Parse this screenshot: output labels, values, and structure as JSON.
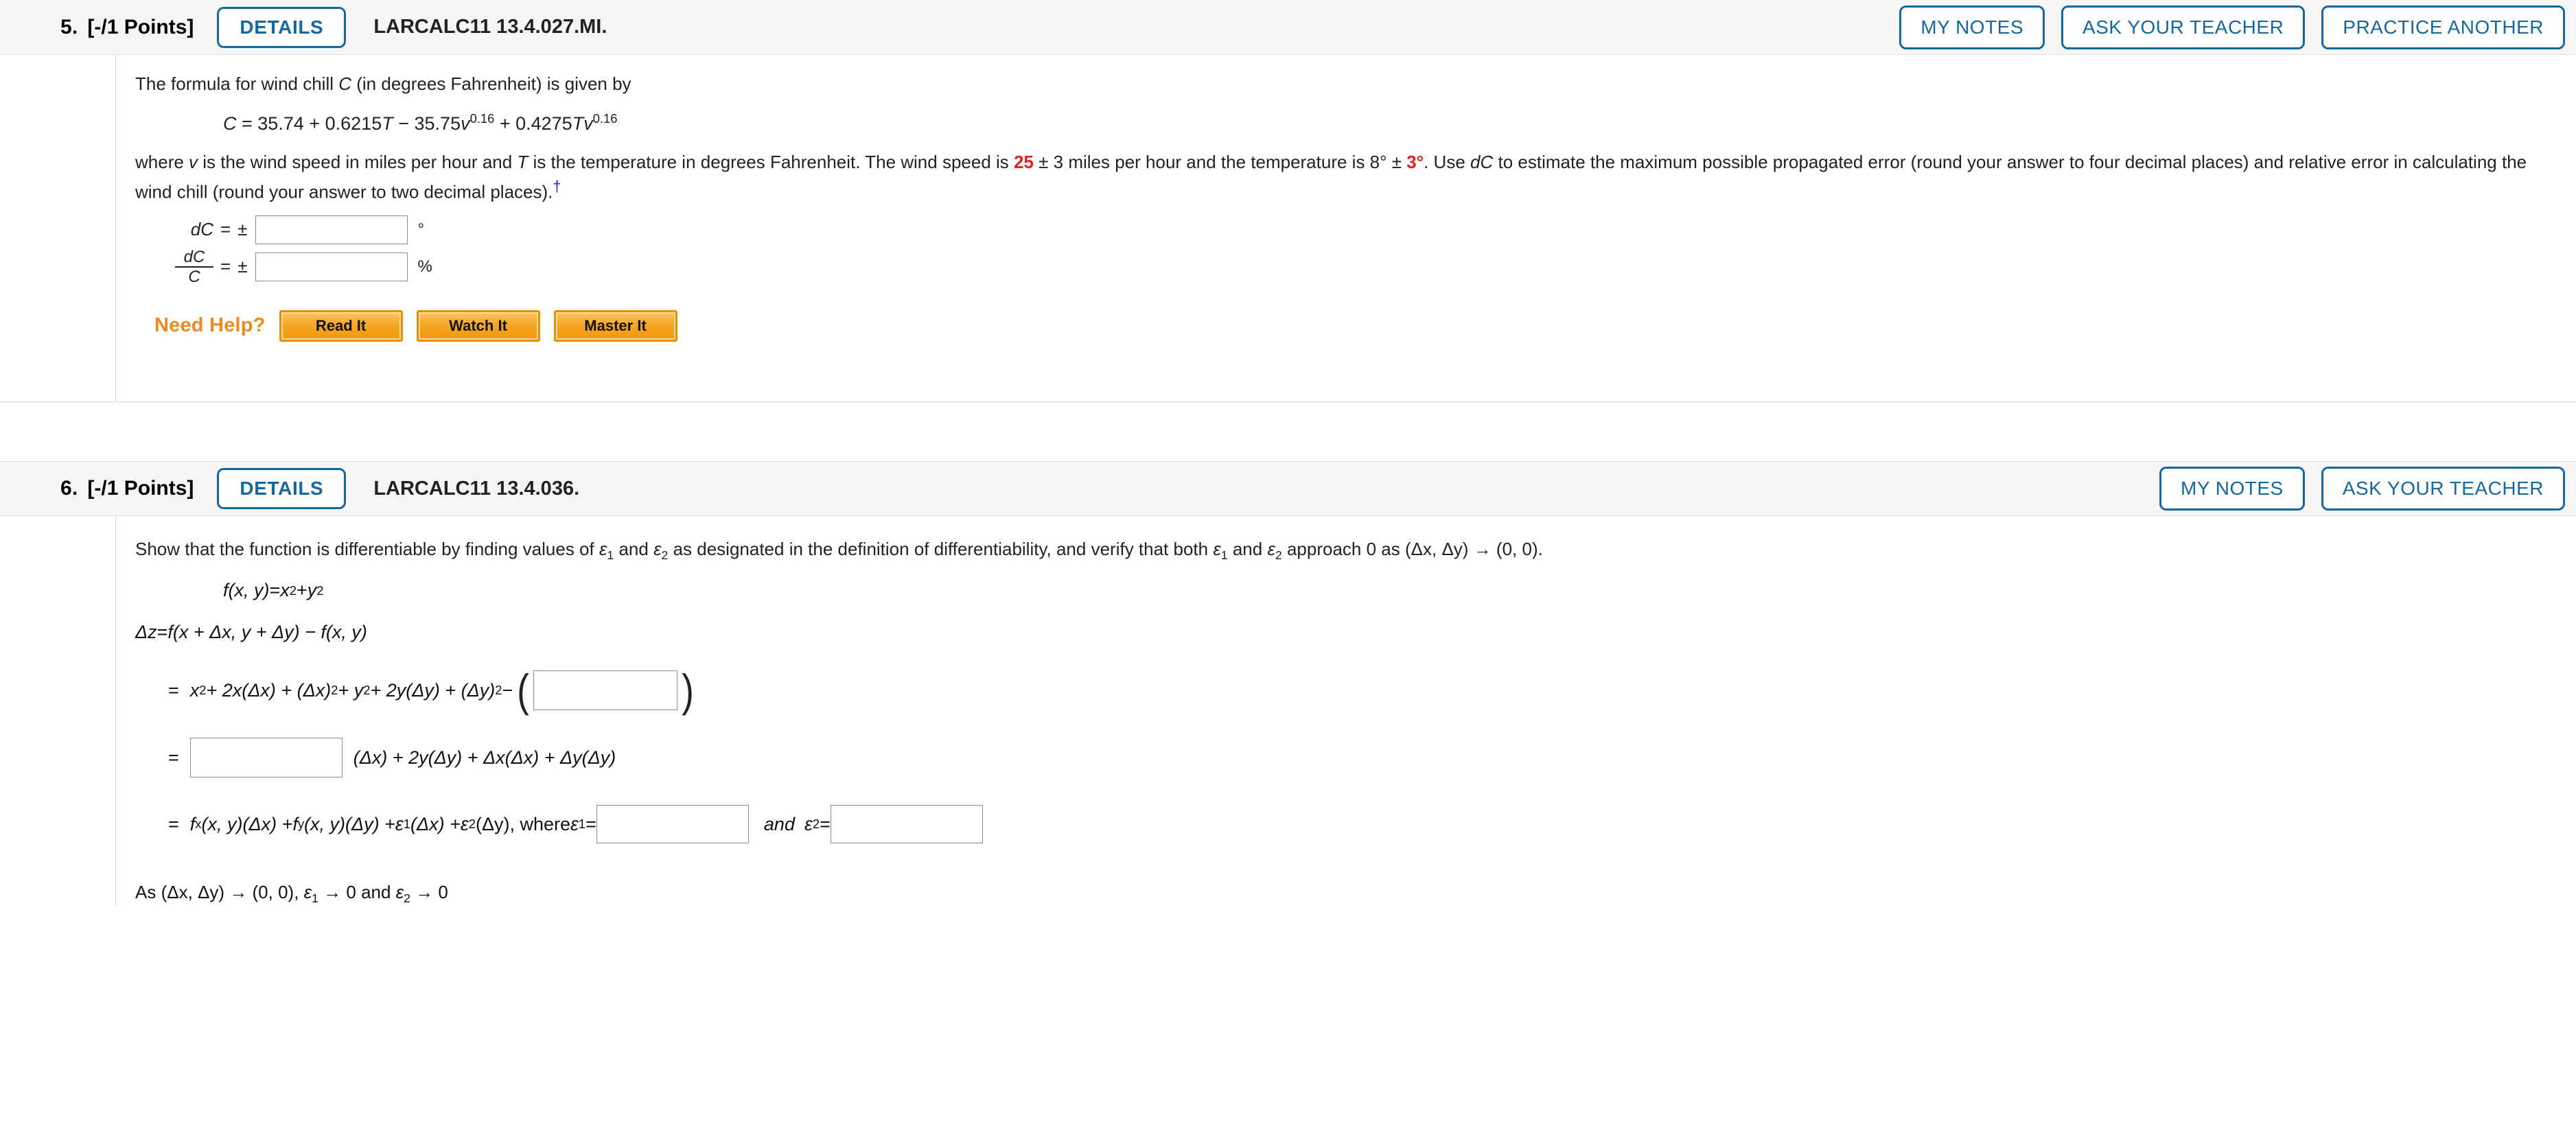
{
  "problems": [
    {
      "number": "5.",
      "points": "[-/1 Points]",
      "details_label": "DETAILS",
      "code": "LARCALC11 13.4.027.MI.",
      "actions": [
        "MY NOTES",
        "ASK YOUR TEACHER",
        "PRACTICE ANOTHER"
      ],
      "intro": "The formula for wind chill C (in degrees Fahrenheit) is given by",
      "intro_parts": {
        "a": "The formula for wind chill ",
        "var": "C",
        "b": " (in degrees Fahrenheit) is given by"
      },
      "formula": "C = 35.74 + 0.6215T − 35.75v^0.16 + 0.4275Tv^0.16",
      "formula_parts": {
        "lhs": "C",
        "eq": " = ",
        "t1": "35.74",
        "p1": " + ",
        "t2": "0.6215",
        "t2v": "T",
        "m1": " − ",
        "t3": "35.75",
        "t3v": "v",
        "exp1": "0.16",
        "p2": " + ",
        "t4": "0.4275",
        "t4v": "Tv",
        "exp2": "0.16"
      },
      "body_text": {
        "s1": "where ",
        "v": "v",
        "s2": " is the wind speed in miles per hour and ",
        "T": "T",
        "s3": " is the temperature in degrees Fahrenheit. The wind speed is ",
        "wind_value": "25",
        "s4": " ± 3 miles per hour and the temperature is 8° ± ",
        "temp_tol": "3°",
        "s5": ". Use ",
        "dC": "dC",
        "s6": " to estimate the maximum possible propagated error (round your answer to four decimal places) and relative error in calculating the wind chill (round your answer to two decimal places).",
        "dagger": "†"
      },
      "answers": [
        {
          "label": "dC",
          "eq": "=",
          "pm": "±",
          "value": "",
          "unit": "°"
        },
        {
          "label_num": "dC",
          "label_den": "C",
          "eq": "=",
          "pm": "±",
          "value": "",
          "unit": "%"
        }
      ],
      "need_help_label": "Need Help?",
      "help_buttons": [
        "Read It",
        "Watch It",
        "Master It"
      ]
    },
    {
      "number": "6.",
      "points": "[-/1 Points]",
      "details_label": "DETAILS",
      "code": "LARCALC11 13.4.036.",
      "actions": [
        "MY NOTES",
        "ASK YOUR TEACHER"
      ],
      "question": {
        "s1": "Show that the function is differentiable by finding values of ",
        "e1": "ε",
        "e1s": "1",
        "s2": " and ",
        "e2": "ε",
        "e2s": "2",
        "s3": " as designated in the definition of differentiability, and verify that both ",
        "s4": " and ",
        "s5": " approach 0 as (Δx, Δy) → (0, 0)."
      },
      "fxy": {
        "lhs": "f(x, y)",
        "eq": " = ",
        "x": "x",
        "sup1": "2",
        "plus": " + ",
        "y": "y",
        "sup2": "2"
      },
      "delta_z": {
        "lhs": "Δz",
        "eq": " = ",
        "rhs": "f(x + Δx, y + Δy) − f(x, y)"
      },
      "line1": {
        "eq": "=",
        "expr_a": "x",
        "sup_a": "2",
        "expr_b": " + 2x(Δx) + (Δx)",
        "sup_b": "2",
        "expr_c": " + y",
        "sup_c": "2",
        "expr_d": " + 2y(Δy) + (Δy)",
        "sup_d": "2",
        "minus": " − ",
        "value": ""
      },
      "line2": {
        "eq": "=",
        "value": "",
        "tail": "(Δx) + 2y(Δy) + Δx(Δx) + Δy(Δy)"
      },
      "line3": {
        "eq": "=",
        "f_x": "f",
        "f_x_sub": "x",
        "term1": "(x, y)(Δx) + ",
        "f_y": "f",
        "f_y_sub": "y",
        "term2": "(x, y)(Δy) + ",
        "eps1": "ε",
        "eps1_sub": "1",
        "term3": "(Δx) + ",
        "eps2": "ε",
        "eps2_sub": "2",
        "term4": "(Δy), where ",
        "where_eps1": "ε",
        "where_eps1_sub": "1",
        "eq2": " = ",
        "value1": "",
        "and": "and",
        "where_eps2": "ε",
        "where_eps2_sub": "2",
        "eq3": " = ",
        "value2": ""
      },
      "conclusion": {
        "s1": "As (Δx, Δy) → (0, 0), ",
        "e1": "ε",
        "e1s": "1",
        "s2": " → 0 and ",
        "e2": "ε",
        "e2s": "2",
        "s3": " → 0"
      }
    }
  ],
  "colors": {
    "accent_blue": "#1368a0",
    "red_value": "#e02020",
    "orange": "#f08a1e",
    "help_button": "#f5a623",
    "link_blue": "#1a1ae0"
  }
}
